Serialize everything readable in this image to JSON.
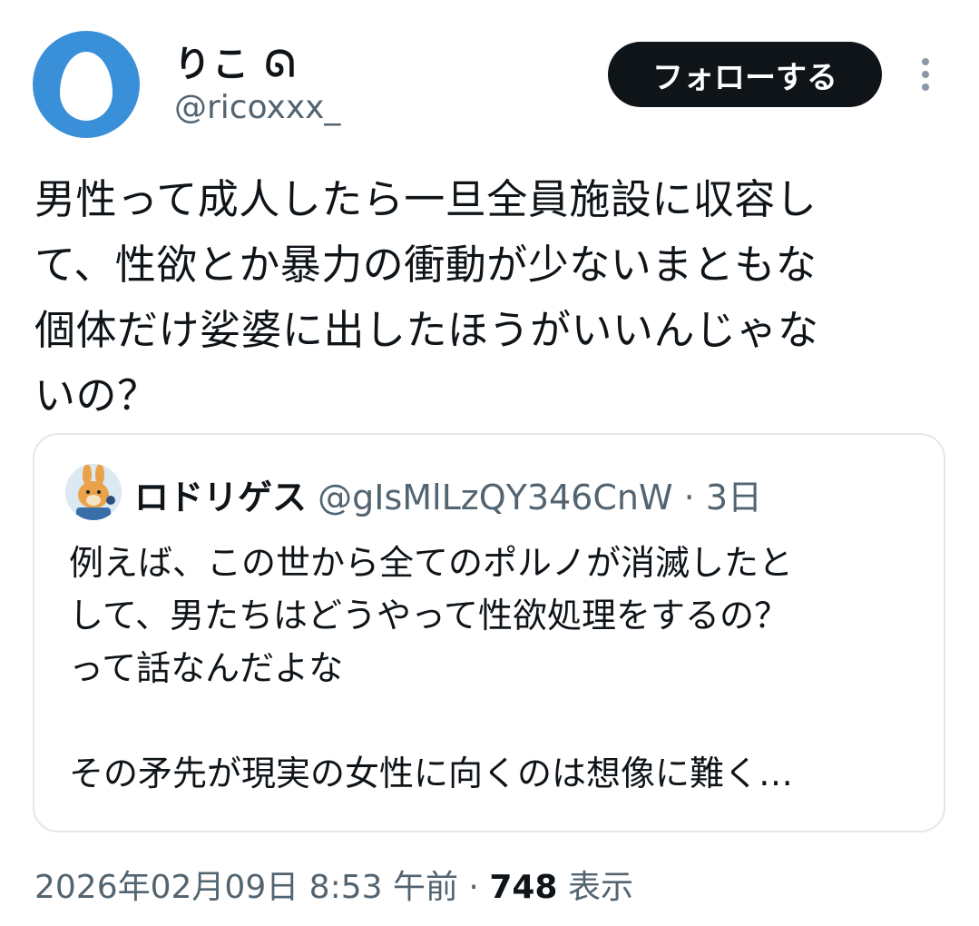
{
  "author": {
    "display_name": "りこ ᘏ",
    "handle": "@ricoxxx_"
  },
  "follow_label": "フォローする",
  "tweet_lines": [
    "男性って成人したら一旦全員施設に収容し",
    "て、性欲とか暴力の衝動が少ないまともな",
    "個体だけ娑婆に出したほうがいいんじゃな",
    "いの？"
  ],
  "quote": {
    "display_name": "ロドリゲス",
    "handle": "@gIsMlLzQY346CnW",
    "separator": "·",
    "time": "3日",
    "lines": [
      "例えば、この世から全てのポルノが消滅したと",
      "して、男たちはどうやって性欲処理をするの？",
      "って話なんだよな",
      "",
      "その矛先が現実の女性に向くのは想像に難く…"
    ]
  },
  "meta": {
    "timestamp": "2026年02月09日 8:53 午前",
    "separator": "·",
    "views_count": "748",
    "views_label": "表示"
  }
}
